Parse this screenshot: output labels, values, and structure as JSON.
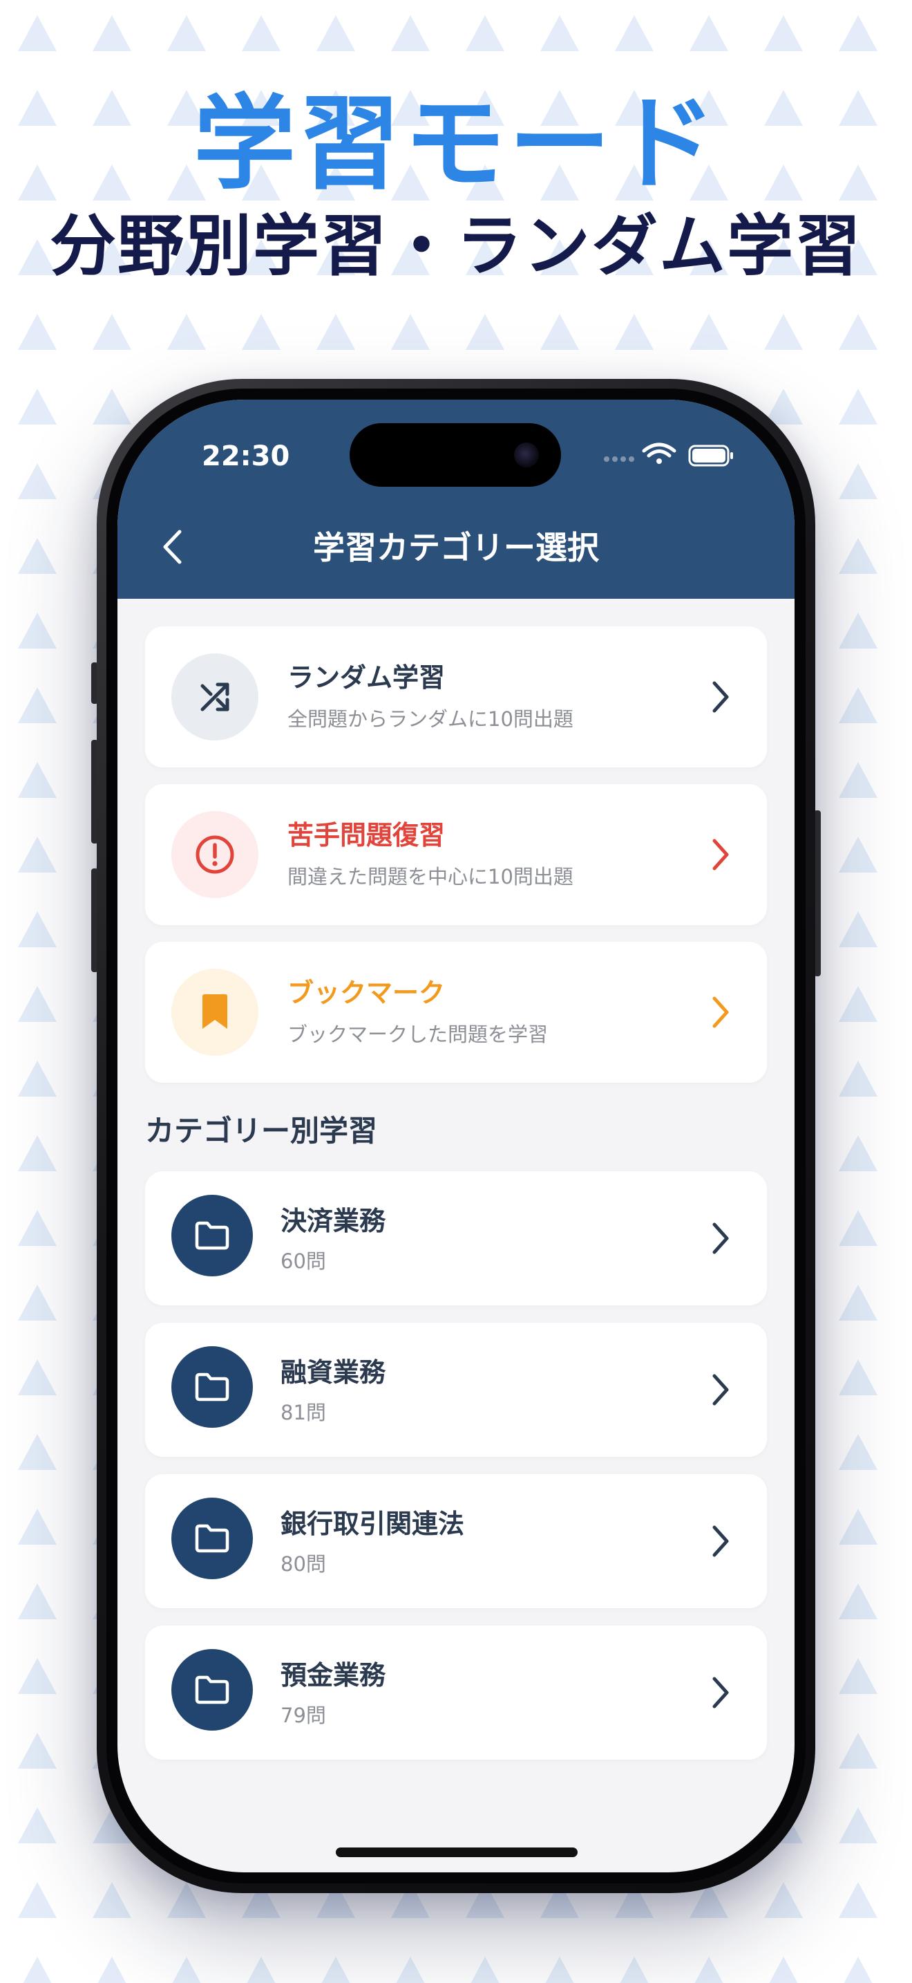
{
  "promo": {
    "headline": "学習モード",
    "subheadline": "分野別学習・ランダム学習"
  },
  "status_bar": {
    "time": "22:30"
  },
  "nav": {
    "title": "学習カテゴリー選択"
  },
  "mode_cards": [
    {
      "title": "ランダム学習",
      "subtitle": "全問題からランダムに10問出題",
      "icon": "shuffle-icon",
      "color": "#2c3a50",
      "icon_bg": "#e9edf2"
    },
    {
      "title": "苦手問題復習",
      "subtitle": "間違えた問題を中心に10問出題",
      "icon": "alert-circle-icon",
      "color": "#e0443a",
      "icon_bg": "#fdeceb"
    },
    {
      "title": "ブックマーク",
      "subtitle": "ブックマークした問題を学習",
      "icon": "bookmark-icon",
      "color": "#f29a1d",
      "icon_bg": "#fff3e2"
    }
  ],
  "section_label": "カテゴリー別学習",
  "categories": [
    {
      "title": "決済業務",
      "count": "60問",
      "icon": "folder-icon"
    },
    {
      "title": "融資業務",
      "count": "81問",
      "icon": "folder-icon"
    },
    {
      "title": "銀行取引関連法",
      "count": "80問",
      "icon": "folder-icon"
    },
    {
      "title": "預金業務",
      "count": "79問",
      "icon": "folder-icon"
    }
  ],
  "colors": {
    "header_bg": "#2b507a",
    "category_icon_bg": "#22456f",
    "headline_blue": "#2d86e6",
    "headline_navy": "#141a4a",
    "pattern_triangle": "#e3ecf8"
  }
}
